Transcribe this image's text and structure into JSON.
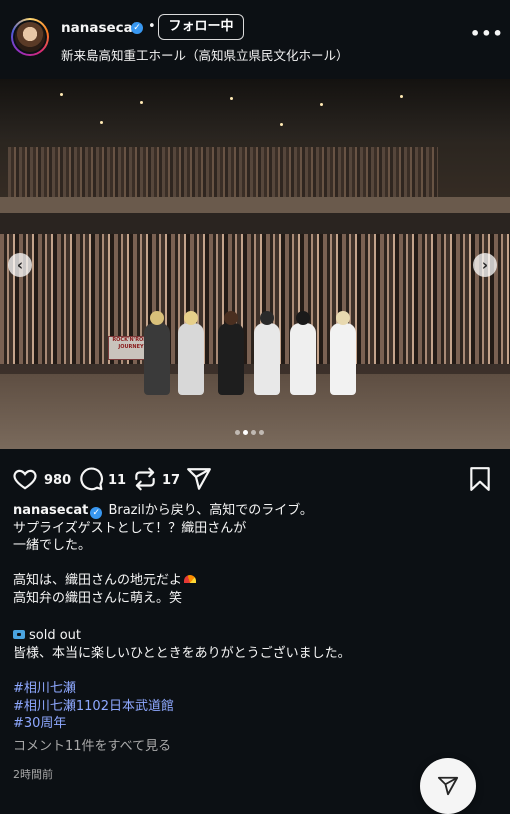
{
  "header": {
    "username": "nanasecat",
    "verified_mark": "✓",
    "separator": "•",
    "follow_label": "フォロー中",
    "location": "新来島高知重工ホール（高知県立県民文化ホール）",
    "more_label": "•••"
  },
  "photo": {
    "banner_text": "ROCK'N'ROLL JOURNEY",
    "prev_arrow": "‹",
    "next_arrow": "›",
    "carousel_count": 4,
    "carousel_active": 2
  },
  "actions": {
    "likes": "980",
    "comments": "11",
    "reposts": "17"
  },
  "caption": {
    "username": "nanasecat",
    "verified_mark": "✓",
    "line1": "Brazilから戻り、高知でのライブ。",
    "line2": "サプライズゲストとして！？織田さんが",
    "line3": "一緒でした。",
    "line4": "高知は、織田さんの地元だよ",
    "line5": "高知弁の織田さんに萌え。笑",
    "line6": "sold out",
    "line7": "皆様、本当に楽しいひとときをありがとうございました。",
    "hashtag1": "#相川七瀬",
    "hashtag2": "#相川七瀬1102日本武道館",
    "hashtag3": "#30周年",
    "comments_link": "コメント11件をすべて見る",
    "time": "2時間前"
  },
  "colors": {
    "background": "#0c1014",
    "hashtag": "#8ea8ff",
    "verified": "#3897f0",
    "muted": "#a8a8a8"
  },
  "icons": [
    "heart-icon",
    "comment-icon",
    "repost-icon",
    "share-icon",
    "bookmark-icon",
    "more-icon",
    "ticket-emoji",
    "rainbow-emoji"
  ]
}
